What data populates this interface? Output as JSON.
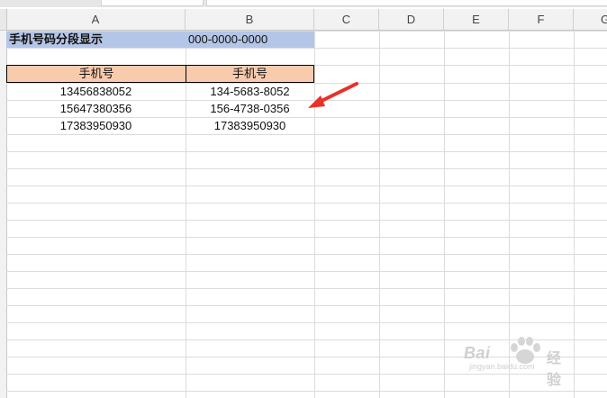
{
  "columns": [
    "A",
    "B",
    "C",
    "D",
    "E",
    "F",
    "G"
  ],
  "sheet": {
    "title_cell": "手机号码分段显示",
    "format_cell": "000-0000-0000",
    "header_a": "手机号",
    "header_b": "手机号",
    "rows": [
      {
        "a": "13456838052",
        "b": "134-5683-8052"
      },
      {
        "a": "15647380356",
        "b": "156-4738-0356"
      },
      {
        "a": "17383950930",
        "b": "17383950930"
      }
    ]
  },
  "annotation": {
    "color": "#e8312a"
  },
  "watermark": {
    "brand": "Bai",
    "brand2": "经验",
    "url": "jingyan.baidu.com"
  }
}
